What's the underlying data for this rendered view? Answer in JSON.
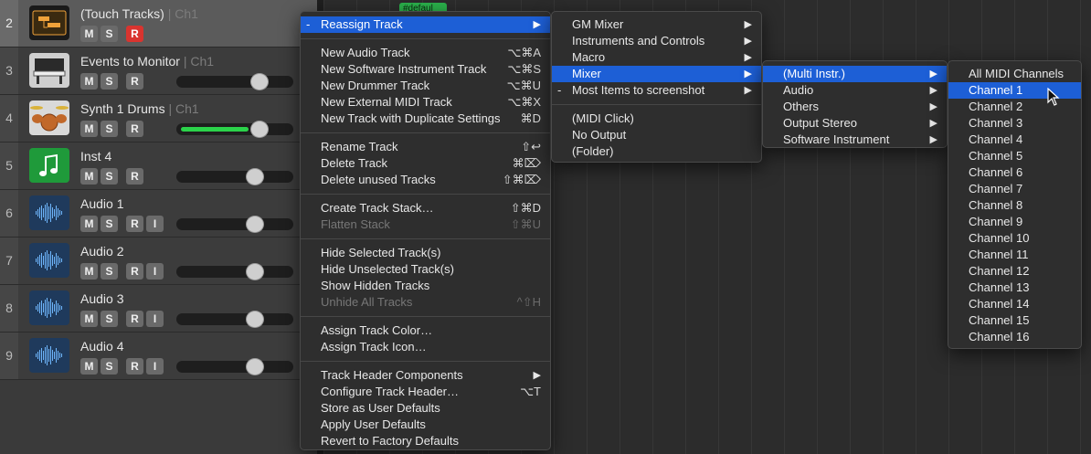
{
  "tracks": [
    {
      "num": "2",
      "name": "(Touch Tracks)",
      "channel": "| Ch1",
      "buttons": [
        "M",
        "S",
        "R"
      ],
      "red": "R",
      "icon": "touch-tracks-icon",
      "selected": true,
      "slider": false
    },
    {
      "num": "3",
      "name": "Events to Monitor",
      "channel": "| Ch1",
      "buttons": [
        "M",
        "S",
        "R"
      ],
      "icon": "piano-icon",
      "slider": true,
      "level": 0.75
    },
    {
      "num": "4",
      "name": "Synth 1 Drums",
      "channel": "| Ch1",
      "buttons": [
        "M",
        "S",
        "R"
      ],
      "icon": "drumkit-icon",
      "slider": true,
      "level": 0.75,
      "fill": 0.63
    },
    {
      "num": "5",
      "name": "Inst 4",
      "channel": "",
      "buttons": [
        "M",
        "S",
        "R"
      ],
      "icon": "music-note-icon",
      "slider": true,
      "level": 0.7
    },
    {
      "num": "6",
      "name": "Audio 1",
      "channel": "",
      "buttons": [
        "M",
        "S",
        "R",
        "I"
      ],
      "icon": "waveform-icon",
      "slider": true,
      "level": 0.7
    },
    {
      "num": "7",
      "name": "Audio 2",
      "channel": "",
      "buttons": [
        "M",
        "S",
        "R",
        "I"
      ],
      "icon": "waveform-icon",
      "slider": true,
      "level": 0.7
    },
    {
      "num": "8",
      "name": "Audio 3",
      "channel": "",
      "buttons": [
        "M",
        "S",
        "R",
        "I"
      ],
      "icon": "waveform-icon",
      "slider": true,
      "level": 0.7
    },
    {
      "num": "9",
      "name": "Audio 4",
      "channel": "",
      "buttons": [
        "M",
        "S",
        "R",
        "I"
      ],
      "icon": "waveform-icon",
      "slider": true,
      "level": 0.7
    }
  ],
  "region_tag": "#defaul",
  "main_menu": {
    "reassign": "Reassign Track",
    "reassign_dash": "-",
    "items": [
      {
        "label": "New Audio Track",
        "sc": "⌥⌘A"
      },
      {
        "label": "New Software Instrument Track",
        "sc": "⌥⌘S"
      },
      {
        "label": "New Drummer Track",
        "sc": "⌥⌘U"
      },
      {
        "label": "New External MIDI Track",
        "sc": "⌥⌘X"
      },
      {
        "label": "New Track with Duplicate Settings",
        "sc": "⌘D"
      },
      {
        "sep": true
      },
      {
        "label": "Rename Track",
        "sc": "⇧↩"
      },
      {
        "label": "Delete Track",
        "sc": "⌘⌦"
      },
      {
        "label": "Delete unused Tracks",
        "sc": "⇧⌘⌦"
      },
      {
        "sep": true
      },
      {
        "label": "Create Track Stack…",
        "sc": "⇧⌘D"
      },
      {
        "label": "Flatten Stack",
        "sc": "⇧⌘U",
        "disabled": true
      },
      {
        "sep": true
      },
      {
        "label": "Hide Selected Track(s)",
        "sc": ""
      },
      {
        "label": "Hide Unselected Track(s)",
        "sc": ""
      },
      {
        "label": "Show Hidden Tracks",
        "sc": ""
      },
      {
        "label": "Unhide All Tracks",
        "sc": "^⇧H",
        "disabled": true
      },
      {
        "sep": true
      },
      {
        "label": "Assign Track Color…",
        "sc": ""
      },
      {
        "label": "Assign Track Icon…",
        "sc": ""
      },
      {
        "sep": true
      },
      {
        "label": "Track Header Components",
        "sc": "",
        "submenu": true
      },
      {
        "label": "Configure Track Header…",
        "sc": "⌥T"
      },
      {
        "label": "Store as User Defaults",
        "sc": ""
      },
      {
        "label": "Apply User Defaults",
        "sc": ""
      },
      {
        "label": "Revert to Factory Defaults",
        "sc": ""
      }
    ]
  },
  "reassign_menu": {
    "items": [
      {
        "label": "GM Mixer",
        "submenu": true
      },
      {
        "label": "Instruments and Controls",
        "submenu": true
      },
      {
        "label": "Macro",
        "submenu": true
      },
      {
        "label": "Mixer",
        "submenu": true,
        "highlight": true
      },
      {
        "label": "Most Items to screenshot",
        "submenu": true,
        "dash": "-"
      },
      {
        "sep": true
      },
      {
        "label": "(MIDI Click)"
      },
      {
        "label": "No Output"
      },
      {
        "label": "(Folder)"
      }
    ]
  },
  "mixer_menu": {
    "items": [
      {
        "label": "(Multi Instr.)",
        "submenu": true,
        "highlight": true
      },
      {
        "label": "Audio",
        "submenu": true
      },
      {
        "label": "Others",
        "submenu": true
      },
      {
        "label": "Output Stereo",
        "submenu": true
      },
      {
        "label": "Software Instrument",
        "submenu": true
      }
    ]
  },
  "channel_menu": {
    "items": [
      "All MIDI Channels",
      "Channel  1",
      "Channel  2",
      "Channel  3",
      "Channel  4",
      "Channel  5",
      "Channel  6",
      "Channel  7",
      "Channel  8",
      "Channel  9",
      "Channel 10",
      "Channel 11",
      "Channel 12",
      "Channel 13",
      "Channel 14",
      "Channel 15",
      "Channel 16"
    ],
    "highlight_index": 1
  },
  "arrow_glyph": "▶"
}
